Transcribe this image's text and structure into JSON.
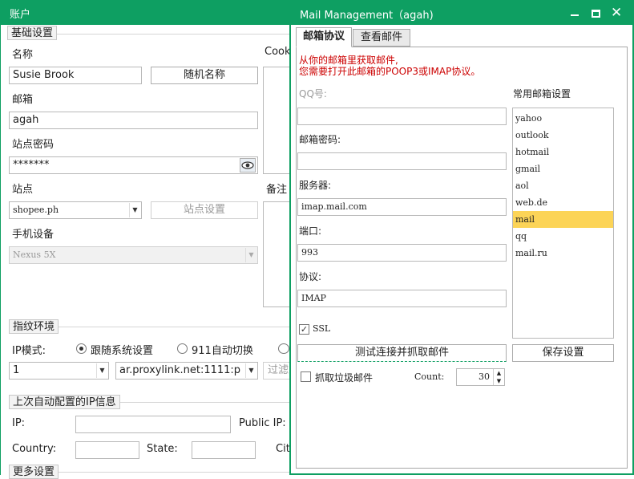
{
  "account_window": {
    "title": "账户",
    "basic_group": "基础设置",
    "name_label": "名称",
    "name_value": "Susie Brook",
    "random_name_button": "随机名称",
    "cookie_label": "Cook",
    "email_label": "邮箱",
    "email_value": "agah",
    "site_password_label": "站点密码",
    "site_password_value": "*******",
    "site_label": "站点",
    "site_value": "shopee.ph",
    "site_settings_button": "站点设置",
    "notes_label": "备注",
    "device_label": "手机设备",
    "device_value": "Nexus 5X",
    "fingerprint_group": "指纹环境",
    "ip_mode_label": "IP模式:",
    "ip_mode_options": [
      "跟随系统设置",
      "911自动切换"
    ],
    "ip_mode_selected": "跟随系统设置",
    "proxy_index_value": "1",
    "proxy_address_value": "ar.proxylink.net:1111:p",
    "filter_button": "过滤",
    "last_ip_group": "上次自动配置的IP信息",
    "ip_label": "IP:",
    "public_ip_label": "Public IP:",
    "country_label": "Country:",
    "state_label": "State:",
    "city_label": "Cit",
    "more_group": "更多设置"
  },
  "mail_window": {
    "title": "Mail Management（agah)",
    "tabs": [
      {
        "label": "邮箱协议",
        "active": true
      },
      {
        "label": "查看邮件",
        "active": false
      }
    ],
    "notice_lines": [
      "从你的邮箱里获取邮件,",
      "您需要打开此邮箱的POOP3或IMAP协议。"
    ],
    "qq_label": "QQ号:",
    "qq_value": "",
    "password_label": "邮箱密码:",
    "password_value": "",
    "server_label": "服务器:",
    "server_value": "imap.mail.com",
    "port_label": "端口:",
    "port_value": "993",
    "protocol_label": "协议:",
    "protocol_value": "IMAP",
    "ssl_label": "SSL",
    "ssl_checked": true,
    "test_button": "测试连接并抓取邮件",
    "junk_label": "抓取垃圾邮件",
    "junk_checked": false,
    "count_label": "Count:",
    "count_value": "30",
    "common_label": "常用邮箱设置",
    "providers": [
      "yahoo",
      "outlook",
      "hotmail",
      "gmail",
      "aol",
      "web.de",
      "mail",
      "qq",
      "mail.ru"
    ],
    "selected_provider": "mail",
    "save_button": "保存设置"
  },
  "colors": {
    "title_bar": "#0e9f62",
    "notice_text": "#cc0000",
    "selected_item": "#fcd457",
    "window_border": "#0e9f62"
  }
}
